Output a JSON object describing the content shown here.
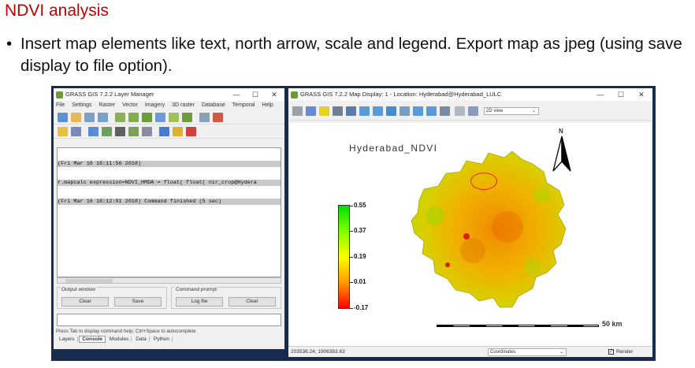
{
  "slide": {
    "title": "NDVI analysis",
    "bullet_marker": "•",
    "bullet": "Insert map elements like text, north arrow, scale and legend. Export map as jpeg (using save display to file option)."
  },
  "layer_manager": {
    "title": "GRASS GIS 7.2.2 Layer Manager",
    "menu": [
      "File",
      "Settings",
      "Raster",
      "Vector",
      "Imagery",
      "3D raster",
      "Database",
      "Temporal",
      "Help"
    ],
    "console_lines": [
      "(Fri Mar 16 18:11:56 2018)",
      "r.mapcalc expression=NDVI_HMDA = float( float( nir_crop@Hydera",
      "(Fri Mar 16 18:12:01 2018) Command finished (5 sec)"
    ],
    "output_window": {
      "label": "Output window",
      "clear": "Clear",
      "save": "Save"
    },
    "command_prompt": {
      "label": "Command prompt",
      "log_file": "Log file",
      "clear": "Clear"
    },
    "hint": "Press Tab to display command help, Ctrl+Space to autocomplete",
    "tabs": [
      "Layers",
      "Console",
      "Modules",
      "Data",
      "Python"
    ],
    "active_tab": "Console"
  },
  "map_display": {
    "title": "GRASS GIS 7.2.2 Map Display: 1 - Location: Hyderabad@Hyderabad_LULC",
    "view_mode": "2D view",
    "map_title": "Hyderabad_NDVI",
    "north_label": "N",
    "legend": [
      "0.55",
      "0.37",
      "0.19",
      "0.01",
      "-0.17"
    ],
    "scale_label": "50 km",
    "status": {
      "coords": "203536.24; 1906383.63",
      "mode": "Coordinates",
      "render": "Render"
    }
  },
  "window_controls": {
    "minimize": "—",
    "maximize": "☐",
    "close": "✕"
  },
  "colors": {
    "title_red": "#c00000",
    "desktop": "#1a2c4d",
    "highlight_circle": "#e02020"
  }
}
